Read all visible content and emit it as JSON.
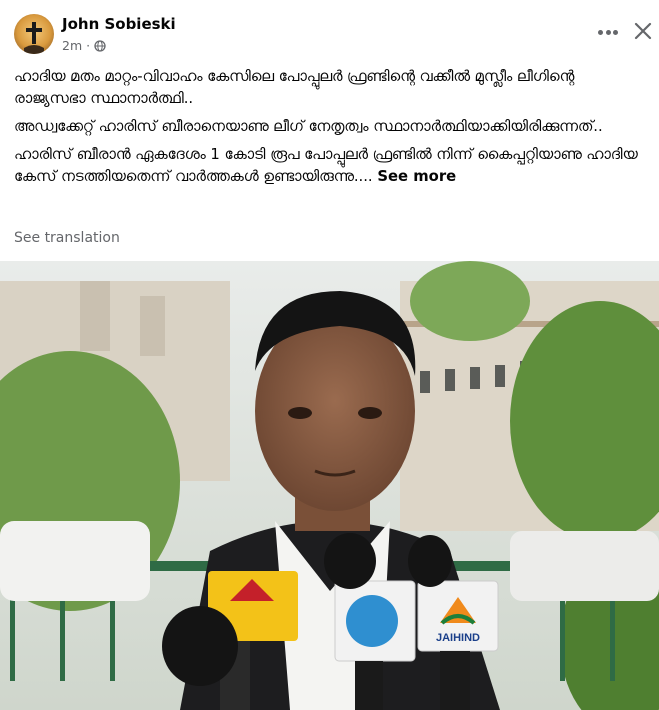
{
  "post": {
    "author": "John Sobieski",
    "timestamp": "2m",
    "privacy_icon": "globe-icon",
    "menu_icon": "more-options-icon",
    "close_icon": "close-icon",
    "paragraphs": [
      "ഹാദിയ മതം മാറ്റം-വിവാഹം കേസിലെ പോപ്പുലർ ഫ്രണ്ടിന്റെ വക്കീൽ മുസ്ലീം ലീഗിന്റെ രാജ്യസഭാ സ്ഥാനാർത്ഥി..",
      "അഡ്വക്കേറ്റ് ഹാരിസ് ബീരാനെയാണു ലീഗ് നേതൃത്വം സ്ഥാനാർത്ഥിയാക്കിയിരിക്കുന്നത്..",
      "ഹാരിസ് ബീരാൻ ഏകദേശം 1 കോടി രൂപ പോപ്പുലർ ഫ്രണ്ടിൽ നിന്ന് കൈപ്പറ്റിയാണു ഹാദിയ കേസ് നടത്തിയതെന്ന് വാർത്തകൾ ഉണ്ടായിരുന്നു...."
    ],
    "see_more": "See more",
    "see_translation": "See translation",
    "microphone_logo_text": "JAIHIND"
  },
  "colors": {
    "text_primary": "#050505",
    "text_secondary": "#65676b",
    "background": "#ffffff"
  }
}
